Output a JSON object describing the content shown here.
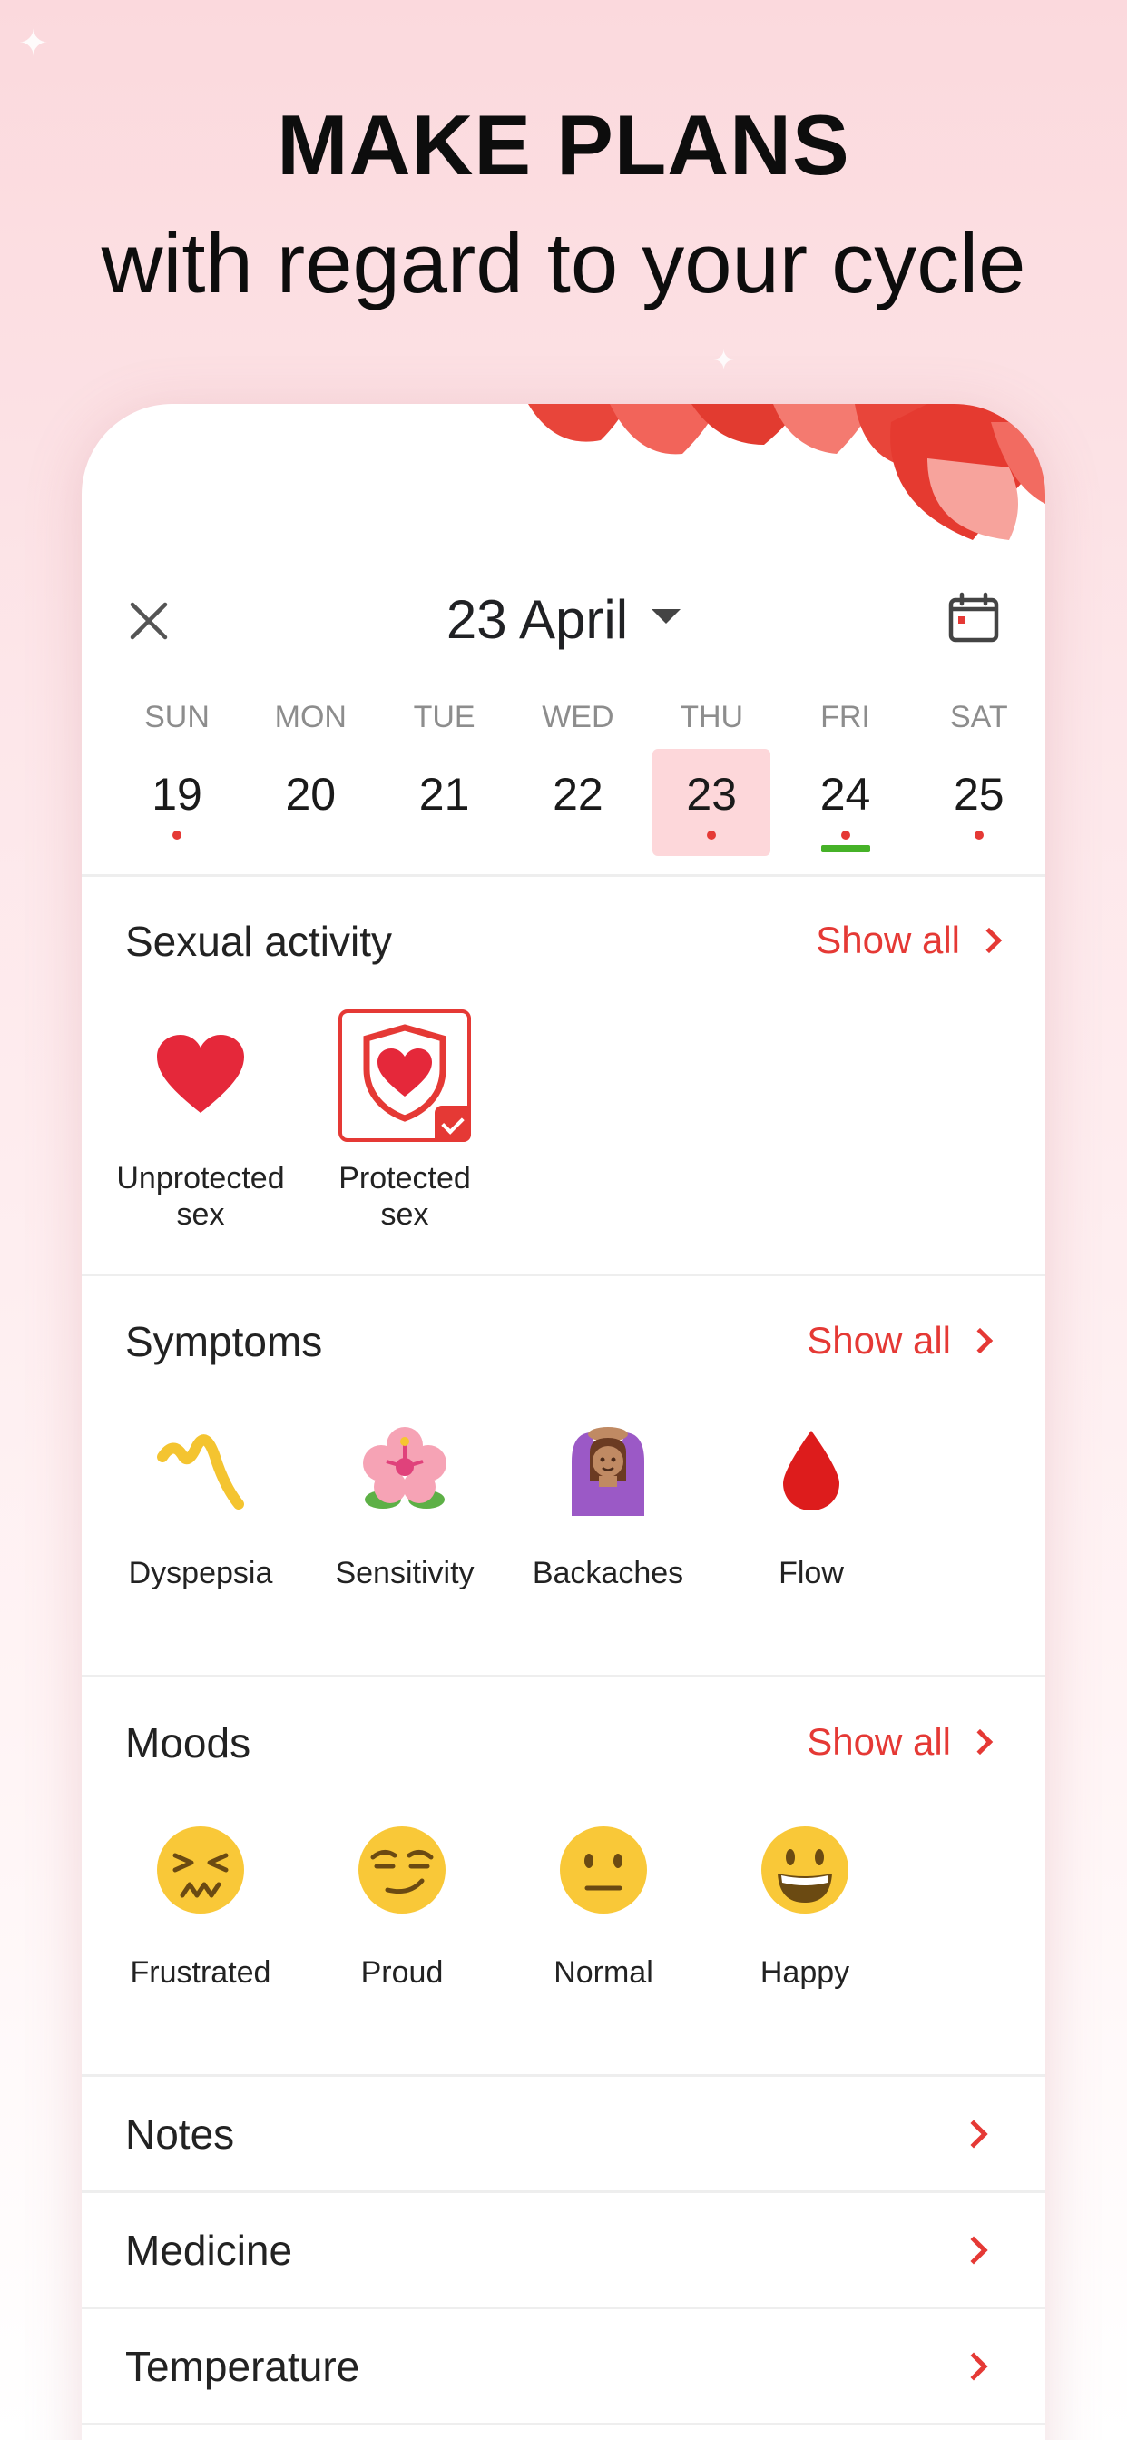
{
  "headline": {
    "line1": "MAKE PLANS",
    "line2": "with regard to your cycle"
  },
  "header": {
    "date": "23 April"
  },
  "week": [
    {
      "name": "SUN",
      "num": "19",
      "dot": true,
      "selected": false,
      "bar": false
    },
    {
      "name": "MON",
      "num": "20",
      "dot": false,
      "selected": false,
      "bar": false
    },
    {
      "name": "TUE",
      "num": "21",
      "dot": false,
      "selected": false,
      "bar": false
    },
    {
      "name": "WED",
      "num": "22",
      "dot": false,
      "selected": false,
      "bar": false
    },
    {
      "name": "THU",
      "num": "23",
      "dot": true,
      "selected": true,
      "bar": false
    },
    {
      "name": "FRI",
      "num": "24",
      "dot": true,
      "selected": false,
      "bar": true
    },
    {
      "name": "SAT",
      "num": "25",
      "dot": true,
      "selected": false,
      "bar": false
    }
  ],
  "sexual_activity": {
    "title": "Sexual activity",
    "show_all": "Show all",
    "items": [
      {
        "label": "Unprotected sex",
        "icon": "heart-icon"
      },
      {
        "label": "Protected sex",
        "icon": "shield-heart-icon",
        "checked": true
      }
    ]
  },
  "symptoms": {
    "title": "Symptoms",
    "show_all": "Show all",
    "items": [
      {
        "label": "Dyspepsia",
        "icon": "squiggle-icon"
      },
      {
        "label": "Sensitivity",
        "icon": "hibiscus-icon"
      },
      {
        "label": "Backaches",
        "icon": "woman-gesturing-ok-icon"
      },
      {
        "label": "Flow",
        "icon": "blood-drop-icon"
      }
    ]
  },
  "moods": {
    "title": "Moods",
    "show_all": "Show all",
    "items": [
      {
        "label": "Frustrated",
        "icon": "persevering-face-icon"
      },
      {
        "label": "Proud",
        "icon": "smirking-face-icon"
      },
      {
        "label": "Normal",
        "icon": "neutral-face-icon"
      },
      {
        "label": "Happy",
        "icon": "grinning-face-icon"
      }
    ]
  },
  "list": [
    "Notes",
    "Medicine",
    "Temperature"
  ],
  "colors": {
    "accent": "#e53935",
    "selected_bg": "#fdd7da",
    "ovulation_bar": "#46b228"
  }
}
